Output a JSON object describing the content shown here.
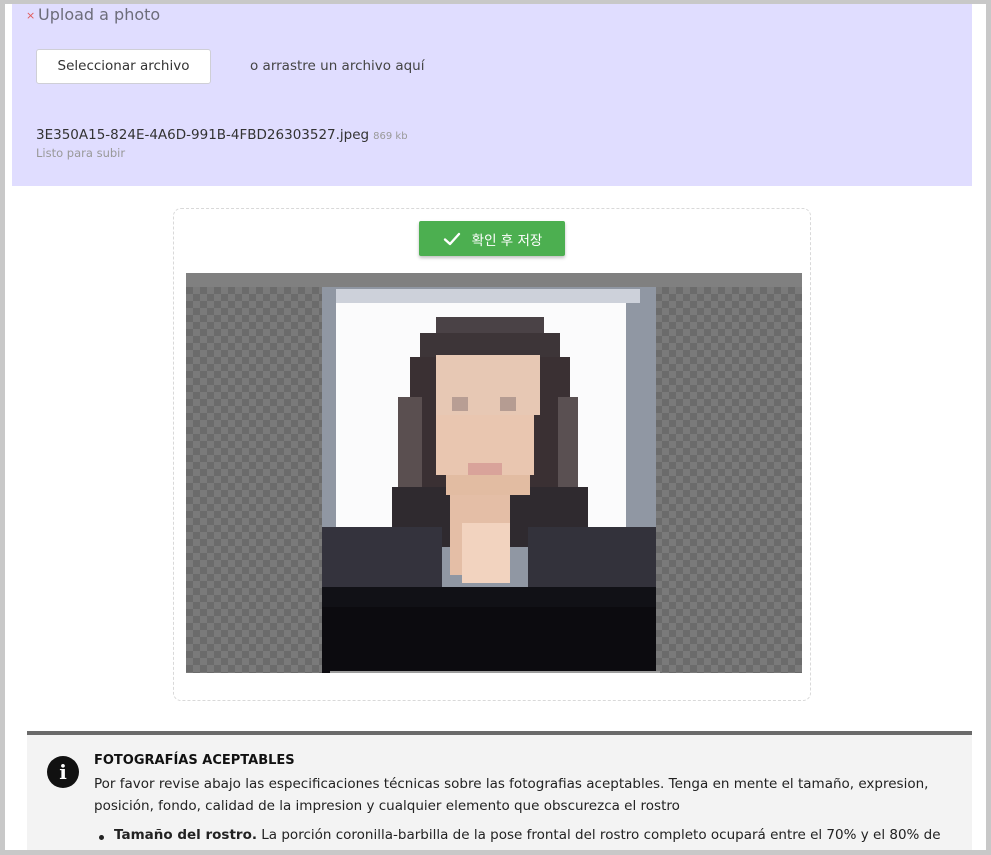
{
  "upload": {
    "required_mark": "×",
    "title": "Upload a photo",
    "select_button": "Seleccionar archivo",
    "drag_text": "o arrastre un archivo aquí",
    "file": {
      "name": "3E350A15-824E-4A6D-991B-4FBD26303527.jpeg",
      "size": "869 kb",
      "status": "Listo para subir"
    }
  },
  "editor": {
    "save_button": "확인 후 저장",
    "save_icon": "check-icon",
    "accent_color": "#4caf50"
  },
  "info": {
    "icon": "info-icon",
    "title": "FOTOGRAFÍAS ACEPTABLES",
    "body": "Por favor revise abajo las especificaciones técnicas sobre las fotografias aceptables. Tenga en mente el tamaño, expresion, posición, fondo, calidad de la impresion y cualquier elemento que obscurezca el rostro",
    "items": [
      {
        "label": "Tamaño del rostro.",
        "text": " La porción coronilla-barbilla de la pose frontal del rostro completo ocupará entre el 70% y el 80% de"
      }
    ]
  }
}
